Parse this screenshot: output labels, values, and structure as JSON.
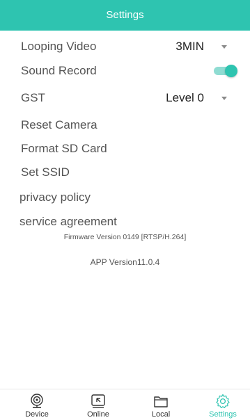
{
  "header": {
    "title": "Settings"
  },
  "settings": {
    "looping_video": {
      "label": "Looping Video",
      "value": "3MIN"
    },
    "sound_record": {
      "label": "Sound Record",
      "enabled": true
    },
    "gst": {
      "label": "GST",
      "value": "Level 0"
    },
    "reset_camera": {
      "label": "Reset Camera"
    },
    "format_sd": {
      "label": "Format SD Card"
    },
    "set_ssid": {
      "label": "Set SSID"
    },
    "privacy_policy": {
      "label": "privacy policy"
    },
    "service_agreement": {
      "label": "service agreement"
    }
  },
  "firmware": {
    "text": "Firmware Version  0149 [RTSP/H.264]"
  },
  "app_version": {
    "text": "APP Version11.0.4"
  },
  "nav": {
    "items": [
      {
        "label": "Device",
        "icon": "webcam-icon"
      },
      {
        "label": "Online",
        "icon": "cast-arrow-icon"
      },
      {
        "label": "Local",
        "icon": "folder-icon"
      },
      {
        "label": "Settings",
        "icon": "gear-icon",
        "active": true
      }
    ]
  },
  "colors": {
    "accent": "#2ec4b0",
    "toggle_track": "#8fdcd2"
  }
}
